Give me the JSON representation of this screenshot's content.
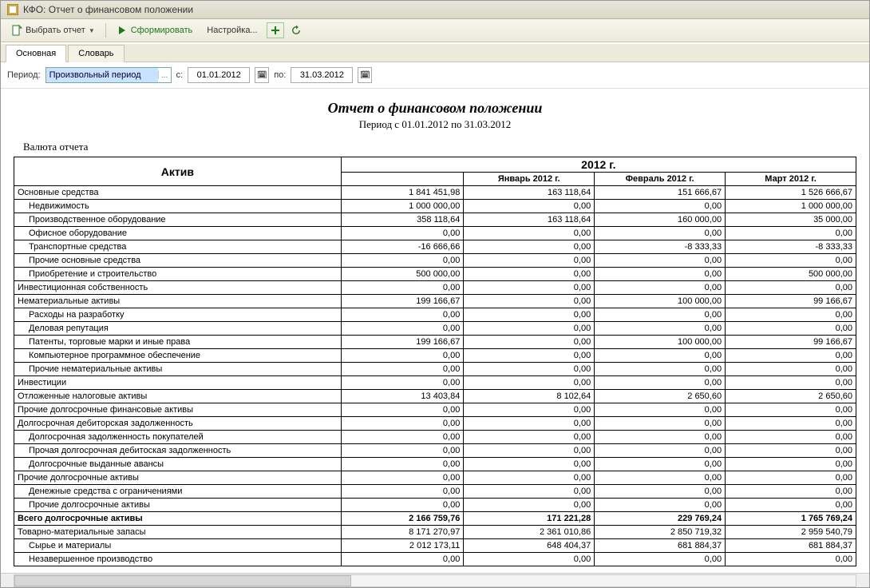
{
  "window": {
    "title": "КФО: Отчет о финансовом положении"
  },
  "toolbar": {
    "select_report": "Выбрать отчет",
    "generate": "Сформировать",
    "settings": "Настройка..."
  },
  "tabs": {
    "main": "Основная",
    "dict": "Словарь"
  },
  "filter": {
    "period_label": "Период:",
    "period_value": "Произвольный период",
    "from_label": "с:",
    "from_value": "01.01.2012",
    "to_label": "по:",
    "to_value": "31.03.2012"
  },
  "report": {
    "title": "Отчет о финансовом положении",
    "subtitle": "Период с 01.01.2012 по 31.03.2012",
    "currency": "Валюта отчета",
    "asset_header": "Актив",
    "year_header": "2012 г.",
    "months": [
      "Январь 2012 г.",
      "Февраль 2012 г.",
      "Март 2012 г."
    ],
    "rows": [
      {
        "label": "Основные средства",
        "v": [
          "1 841 451,98",
          "163 118,64",
          "151 666,67",
          "1 526 666,67"
        ],
        "ind": 0
      },
      {
        "label": "Недвижимость",
        "v": [
          "1 000 000,00",
          "0,00",
          "0,00",
          "1 000 000,00"
        ],
        "ind": 1
      },
      {
        "label": "Производственное оборудование",
        "v": [
          "358 118,64",
          "163 118,64",
          "160 000,00",
          "35 000,00"
        ],
        "ind": 1
      },
      {
        "label": "Офисное оборудование",
        "v": [
          "0,00",
          "0,00",
          "0,00",
          "0,00"
        ],
        "ind": 1
      },
      {
        "label": "Транспортные средства",
        "v": [
          "-16 666,66",
          "0,00",
          "-8 333,33",
          "-8 333,33"
        ],
        "ind": 1
      },
      {
        "label": "Прочие основные средства",
        "v": [
          "0,00",
          "0,00",
          "0,00",
          "0,00"
        ],
        "ind": 1
      },
      {
        "label": "Приобретение и строительство",
        "v": [
          "500 000,00",
          "0,00",
          "0,00",
          "500 000,00"
        ],
        "ind": 1
      },
      {
        "label": "Инвестиционная собственность",
        "v": [
          "0,00",
          "0,00",
          "0,00",
          "0,00"
        ],
        "ind": 0
      },
      {
        "label": "Нематериальные активы",
        "v": [
          "199 166,67",
          "0,00",
          "100 000,00",
          "99 166,67"
        ],
        "ind": 0
      },
      {
        "label": "Расходы на разработку",
        "v": [
          "0,00",
          "0,00",
          "0,00",
          "0,00"
        ],
        "ind": 1
      },
      {
        "label": "Деловая репутация",
        "v": [
          "0,00",
          "0,00",
          "0,00",
          "0,00"
        ],
        "ind": 1
      },
      {
        "label": "Патенты, торговые марки и иные права",
        "v": [
          "199 166,67",
          "0,00",
          "100 000,00",
          "99 166,67"
        ],
        "ind": 1
      },
      {
        "label": "Компьютерное программное обеспечение",
        "v": [
          "0,00",
          "0,00",
          "0,00",
          "0,00"
        ],
        "ind": 1
      },
      {
        "label": "Прочие нематериальные активы",
        "v": [
          "0,00",
          "0,00",
          "0,00",
          "0,00"
        ],
        "ind": 1
      },
      {
        "label": "Инвестиции",
        "v": [
          "0,00",
          "0,00",
          "0,00",
          "0,00"
        ],
        "ind": 0
      },
      {
        "label": "Отложенные налоговые активы",
        "v": [
          "13 403,84",
          "8 102,64",
          "2 650,60",
          "2 650,60"
        ],
        "ind": 0
      },
      {
        "label": "Прочие долгосрочные финансовые активы",
        "v": [
          "0,00",
          "0,00",
          "0,00",
          "0,00"
        ],
        "ind": 0
      },
      {
        "label": "Долгосрочная дебиторская задолженность",
        "v": [
          "0,00",
          "0,00",
          "0,00",
          "0,00"
        ],
        "ind": 0
      },
      {
        "label": "Долгосрочная задолженность покупателей",
        "v": [
          "0,00",
          "0,00",
          "0,00",
          "0,00"
        ],
        "ind": 1
      },
      {
        "label": "Прочая долгосрочная дебитоская задолженность",
        "v": [
          "0,00",
          "0,00",
          "0,00",
          "0,00"
        ],
        "ind": 1
      },
      {
        "label": "Долгосрочные выданные авансы",
        "v": [
          "0,00",
          "0,00",
          "0,00",
          "0,00"
        ],
        "ind": 1
      },
      {
        "label": "Прочие долгосрочные активы",
        "v": [
          "0,00",
          "0,00",
          "0,00",
          "0,00"
        ],
        "ind": 0
      },
      {
        "label": "Денежные средства с ограничениями",
        "v": [
          "0,00",
          "0,00",
          "0,00",
          "0,00"
        ],
        "ind": 1
      },
      {
        "label": "Прочие долгосрочные активы",
        "v": [
          "0,00",
          "0,00",
          "0,00",
          "0,00"
        ],
        "ind": 1
      },
      {
        "label": "Всего долгосрочные активы",
        "v": [
          "2 166 759,76",
          "171 221,28",
          "229 769,24",
          "1 765 769,24"
        ],
        "ind": 0,
        "bold": true
      },
      {
        "label": "Товарно-материальные запасы",
        "v": [
          "8 171 270,97",
          "2 361 010,86",
          "2 850 719,32",
          "2 959 540,79"
        ],
        "ind": 0
      },
      {
        "label": "Сырье и материалы",
        "v": [
          "2 012 173,11",
          "648 404,37",
          "681 884,37",
          "681 884,37"
        ],
        "ind": 1
      },
      {
        "label": "Незавершенное производство",
        "v": [
          "0,00",
          "0,00",
          "0,00",
          "0,00"
        ],
        "ind": 1
      }
    ]
  }
}
